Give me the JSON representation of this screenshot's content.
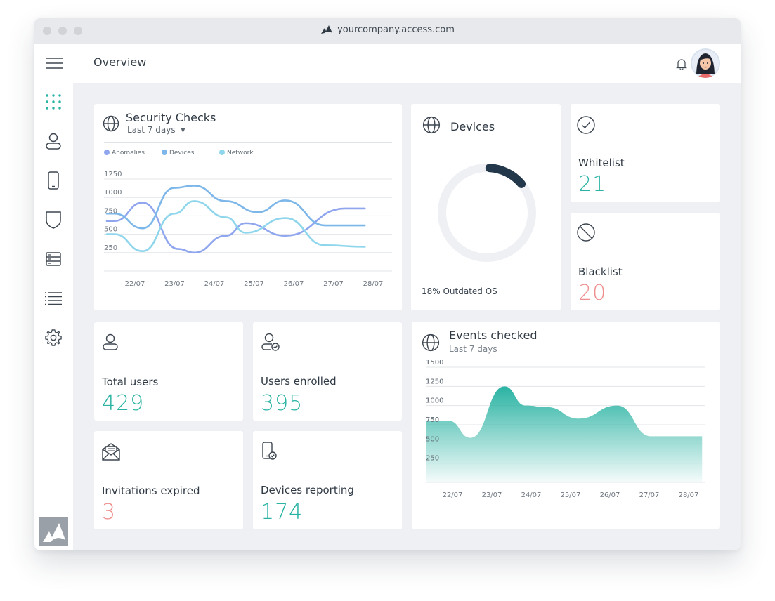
{
  "browser": {
    "url": "yourcompany.access.com"
  },
  "header": {
    "title": "Overview"
  },
  "sidebar": {
    "icons": [
      "menu-icon",
      "dashboard-grid-icon",
      "user-icon",
      "mobile-icon",
      "shield-icon",
      "server-icon",
      "list-icon",
      "gear-icon"
    ]
  },
  "security_checks": {
    "title": "Security Checks",
    "period": "Last 7 days",
    "legend": [
      "Anomalies",
      "Devices",
      "Network"
    ]
  },
  "devices": {
    "title": "Devices",
    "caption": "18% Outdated OS",
    "outdated_pct": 18
  },
  "whitelist": {
    "label": "Whitelist",
    "value": "21"
  },
  "blacklist": {
    "label": "Blacklist",
    "value": "20"
  },
  "total_users": {
    "label": "Total users",
    "value": "429"
  },
  "users_enrolled": {
    "label": "Users enrolled",
    "value": "395"
  },
  "invitations_expired": {
    "label": "Invitations expired",
    "value": "3"
  },
  "devices_reporting": {
    "label": "Devices reporting",
    "value": "174"
  },
  "events_checked": {
    "title": "Events checked",
    "period": "Last 7 days"
  },
  "colors": {
    "teal": "#2ab3a3",
    "coral": "#ee8e8e",
    "anomalies": "#8fa6ef",
    "devices": "#7db7ea",
    "network": "#8fd6ec"
  },
  "chart_data": [
    {
      "type": "line",
      "title": "Security Checks",
      "categories": [
        "22/07",
        "23/07",
        "24/07",
        "25/07",
        "26/07",
        "27/07",
        "28/07"
      ],
      "yticks": [
        250,
        500,
        750,
        1000,
        1250
      ],
      "ylim": [
        0,
        1250
      ],
      "series": [
        {
          "name": "Anomalies",
          "x": [
            0,
            0.2,
            0.9,
            1.8,
            2.2,
            3.0,
            3.5,
            4.5,
            6.0,
            6.5
          ],
          "values": [
            680,
            680,
            930,
            300,
            250,
            480,
            650,
            480,
            850,
            850
          ]
        },
        {
          "name": "Devices",
          "x": [
            0,
            0.2,
            0.9,
            1.7,
            2.2,
            3.0,
            3.8,
            4.5,
            5.5,
            6.5
          ],
          "values": [
            780,
            780,
            580,
            1130,
            1160,
            950,
            800,
            960,
            620,
            620
          ]
        },
        {
          "name": "Network",
          "x": [
            0,
            0.2,
            0.9,
            1.7,
            2.2,
            3.0,
            3.5,
            4.5,
            5.5,
            6.5
          ],
          "values": [
            500,
            500,
            270,
            780,
            950,
            730,
            520,
            720,
            350,
            330
          ]
        }
      ]
    },
    {
      "type": "area",
      "title": "Events checked",
      "categories": [
        "22/07",
        "23/07",
        "24/07",
        "25/07",
        "26/07",
        "27/07",
        "28/07"
      ],
      "yticks": [
        250,
        500,
        750,
        1000,
        1250,
        1500
      ],
      "ylim": [
        0,
        1500
      ],
      "x": [
        0,
        0.55,
        1.05,
        1.85,
        2.35,
        2.85,
        3.6,
        4.5,
        5.3,
        6.5
      ],
      "values": [
        800,
        800,
        580,
        1250,
        1000,
        980,
        830,
        1000,
        600,
        600
      ]
    },
    {
      "type": "pie",
      "title": "Devices",
      "categories": [
        "Outdated OS"
      ],
      "values": [
        18
      ]
    }
  ]
}
